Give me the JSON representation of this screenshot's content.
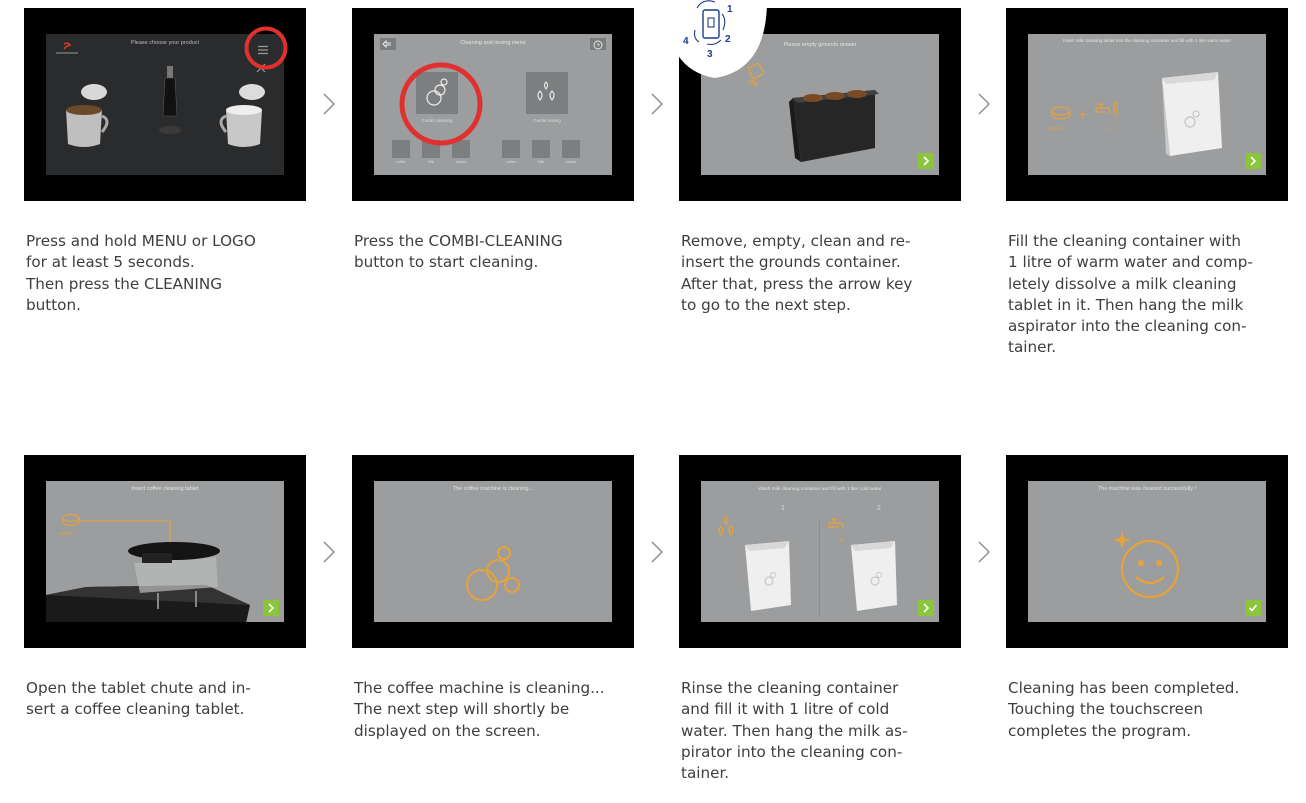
{
  "steps": [
    {
      "screen_title": "Please choose your product",
      "caption": "Press and hold MENU or LOGO\nfor at least 5 seconds.\nThen press the CLEANING\nbutton."
    },
    {
      "screen_title": "Cleaning and rinsing menu",
      "button_left": "Combi cleaning",
      "button_right": "Combi rinsing",
      "small_labels": [
        "coffee",
        "Milk",
        "Instant",
        "coffee",
        "Milk",
        "Instant"
      ],
      "caption": "Press the COMBI-CLEANING\nbutton to start cleaning."
    },
    {
      "screen_title": "Please empty grounds drawer",
      "badge_numbers": [
        "1",
        "2",
        "3",
        "4"
      ],
      "caption": "Remove, empty, clean and re-\ninsert the grounds container.\nAfter that, press the arrow key\nto go to the next step."
    },
    {
      "screen_title": "Insert milk cleaning tablet into the cleaning container and fill with 1 liter warm water",
      "tablet_code": "082516",
      "water_amount": "1L",
      "caption": "Fill the cleaning container with\n1 litre of warm water and comp-\nletely dissolve a milk cleaning\ntablet in it. Then hang the milk\naspirator into the cleaning con-\ntainer."
    },
    {
      "screen_title": "Insert coffee cleaning tablet",
      "tablet_code": "082387",
      "caption": "Open the tablet chute and in-\nsert a coffee cleaning tablet."
    },
    {
      "screen_title": "The coffee machine is cleaning...",
      "caption": "The coffee machine is cleaning...\nThe next step will shortly be\ndisplayed on the screen."
    },
    {
      "screen_title": "Wash milk cleaning container and fill with 1 liter cold water",
      "step_numbers": [
        "1",
        "2"
      ],
      "water_amount": "1L",
      "caption": "Rinse the cleaning container\nand fill it with 1 litre of cold\nwater. Then hang the milk as-\npirator into the cleaning con-\ntainer."
    },
    {
      "screen_title": "The machine was cleaned successfully !",
      "caption": "Cleaning has been completed.\nTouching the touchscreen\ncompletes the program."
    }
  ],
  "colors": {
    "accent_orange": "#e8a23a",
    "confirm_green": "#8cc43c",
    "highlight_red": "#e0312f",
    "screen_grey": "#9b9d9e"
  },
  "icons": {
    "next": "chevron-right-icon",
    "done": "checkmark-icon",
    "flow": "chevron-right-icon"
  }
}
